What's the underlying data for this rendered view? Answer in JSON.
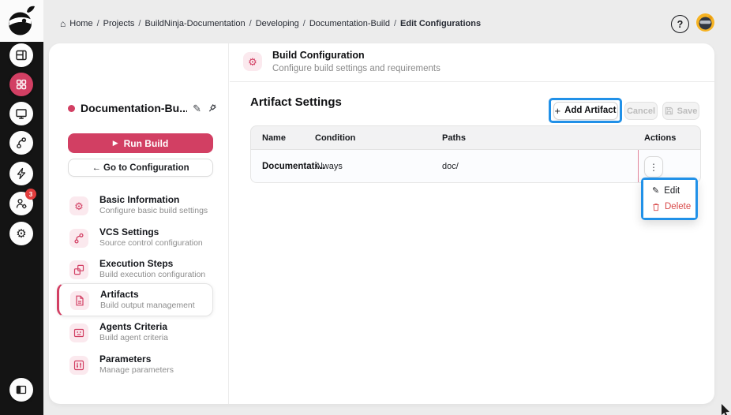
{
  "colors": {
    "accent": "#d23f63",
    "annotation": "#2191e8",
    "chip_bg": "#fbe9ee",
    "danger": "#d84848",
    "badge": "#e23d3d",
    "avatar_bg": "#f6b323"
  },
  "icons": {
    "home": "⌂",
    "gear": "⚙",
    "pencil": "✎",
    "play": "▶",
    "plus": "+",
    "help": "?",
    "kebab": "⋮"
  },
  "rail": {
    "badge_count": "3"
  },
  "breadcrumb": {
    "separator": "/",
    "items": [
      "Home",
      "Projects",
      "BuildNinja-Documentation",
      "Developing",
      "Documentation-Build",
      "Edit Configurations"
    ]
  },
  "panel": {
    "title": "Documentation-Bu...",
    "run_label": "Run Build",
    "goto_label": "← Go to Configuration",
    "nav": [
      {
        "label": "Basic Information",
        "desc": "Configure basic build settings"
      },
      {
        "label": "VCS Settings",
        "desc": "Source control configuration"
      },
      {
        "label": "Execution Steps",
        "desc": "Build execution configuration"
      },
      {
        "label": "Artifacts",
        "desc": "Build output management"
      },
      {
        "label": "Agents Criteria",
        "desc": "Build agent criteria"
      },
      {
        "label": "Parameters",
        "desc": "Manage parameters"
      }
    ]
  },
  "main": {
    "header_title": "Build Configuration",
    "header_subtitle": "Configure build settings and requirements",
    "section_title": "Artifact Settings",
    "add_label": "Add Artifact",
    "cancel_label": "Cancel",
    "save_label": "Save",
    "table": {
      "columns": [
        "Name",
        "Condition",
        "Paths",
        "Actions"
      ],
      "rows": [
        {
          "name": "Documentati...",
          "condition": "Always",
          "paths": "doc/"
        }
      ]
    },
    "menu": {
      "edit_label": "Edit",
      "delete_label": "Delete"
    }
  }
}
